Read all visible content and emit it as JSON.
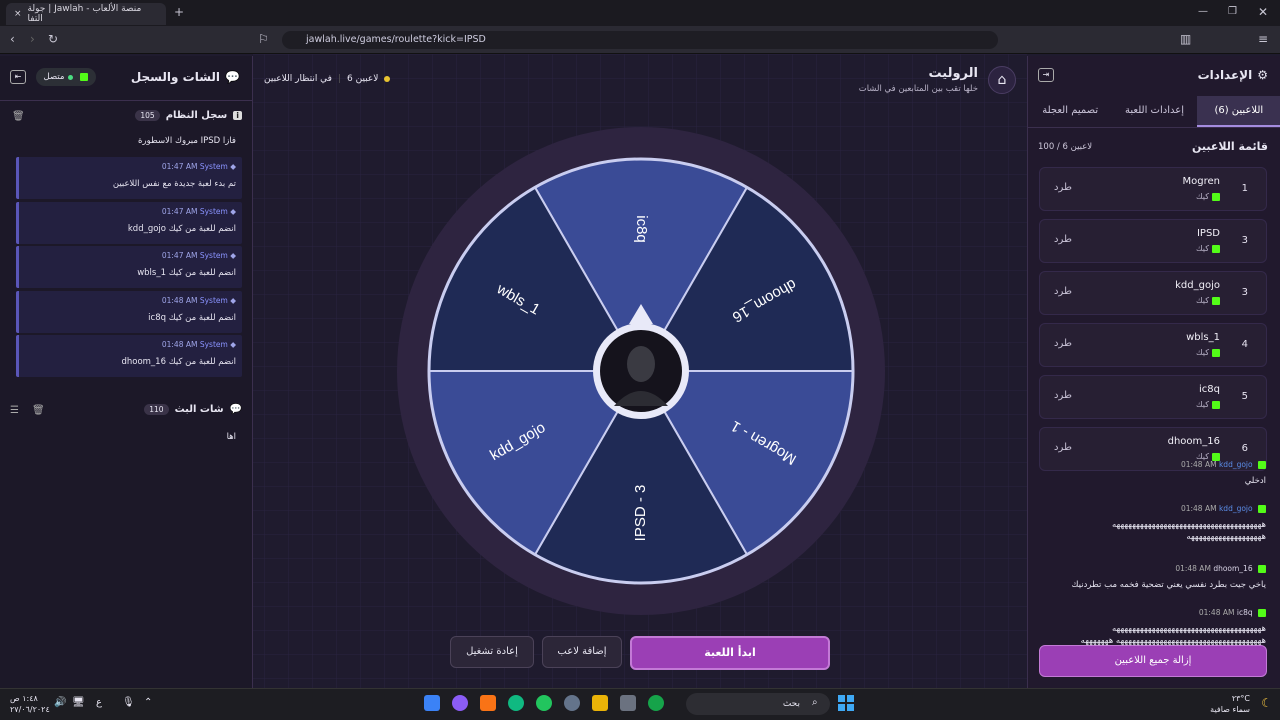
{
  "browser": {
    "tab_title": "جولة | Jawlah - منصة الألعاب التفا",
    "url": "jawlah.live/games/roulette?kick=IPSD"
  },
  "header": {
    "title": "الروليت",
    "subtitle": "خلها تقب بين المتابعين في الشات",
    "players_count": "6 لاعبين",
    "status": "في انتظار اللاعبين"
  },
  "settings": {
    "title": "الإعدادات",
    "tabs": [
      "اللاعبين (6)",
      "إعدادات اللعبة",
      "تصميم العجلة"
    ],
    "list_title": "قائمة اللاعبين",
    "list_count": "100 / 6 لاعبين",
    "platform": "كيك",
    "kick_label": "طرد",
    "players": [
      {
        "num": "1",
        "name": "Mogren"
      },
      {
        "num": "3",
        "name": "IPSD"
      },
      {
        "num": "3",
        "name": "kdd_gojo"
      },
      {
        "num": "4",
        "name": "wbls_1"
      },
      {
        "num": "5",
        "name": "ic8q"
      },
      {
        "num": "6",
        "name": "dhoom_16"
      }
    ],
    "remove_all": "إزالة جميع اللاعبين"
  },
  "chat": {
    "title": "الشات والسجل",
    "connected": "متصل",
    "system_log": "سجل النظام",
    "system_count": "105",
    "first_line": "مبروك الاسطورة IPSD فازا",
    "system_messages": [
      {
        "user": "System",
        "time": "01:47 AM",
        "text": "تم بدء لعبة جديدة مع نفس اللاعبين"
      },
      {
        "user": "System",
        "time": "01:47 AM",
        "text": "kdd_gojo انضم للعبة من كيك"
      },
      {
        "user": "System",
        "time": "01:47 AM",
        "text": "wbls_1 انضم للعبة من كيك"
      },
      {
        "user": "System",
        "time": "01:48 AM",
        "text": "ic8q انضم للعبة من كيك"
      },
      {
        "user": "System",
        "time": "01:48 AM",
        "text": "dhoom_16 انضم للعبة من كيك"
      }
    ],
    "stream_chat": "شات البث",
    "stream_count": "110",
    "stream_first": "اها",
    "messages": [
      {
        "user": "kdd_gojo",
        "time": "01:48 AM",
        "text": "ادخلي",
        "color": "#5b8de8"
      },
      {
        "user": "kdd_gojo",
        "time": "01:48 AM",
        "text": "ههههههههههههههههههههههههههههههههههههههه هههههههههههههههههههه",
        "color": "#5b8de8"
      },
      {
        "user": "dhoom_16",
        "time": "01:48 AM",
        "text": "ياخي جيت بطرد نفسي يعني تضحية فخمه مب تطردنيك",
        "color": "#d9d4e6"
      },
      {
        "user": "ic8q",
        "time": "01:48 AM",
        "text": "ههههههههههههههههههههههههههههههههههههههه هههههههههههههههههههههههههههههههههههههه هههههههه",
        "color": "#d9d4e6"
      }
    ]
  },
  "wheel": {
    "segments": [
      "ic8q",
      "dhoom_16",
      "Mogren - 1",
      "IPSD - 3",
      "kdd_gojo",
      "wbls_1"
    ],
    "colors": {
      "light": "#3a4b96",
      "dark": "#1f2a55",
      "rim": "#2e2440",
      "border": "#c9cdf0"
    }
  },
  "actions": {
    "start": "ابدأ اللعبة",
    "add_player": "إضافة لاعب",
    "restart": "إعادة تشغيل"
  },
  "taskbar": {
    "search": "بحث",
    "weather_temp": "٢٣°C",
    "weather_text": "سماء صافية",
    "time": "١:٤٨ ص",
    "date": "٢٧/٠٦/٢٠٢٤",
    "lang": "ع"
  },
  "accent": "#9b3fb5"
}
